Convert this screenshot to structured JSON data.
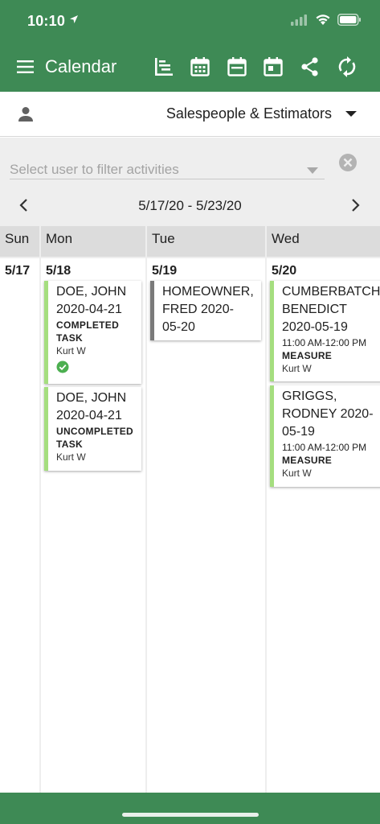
{
  "status": {
    "time": "10:10"
  },
  "toolbar": {
    "title": "Calendar",
    "icons": [
      "menu-icon",
      "gantt-view-icon",
      "month-view-icon",
      "week-view-icon",
      "day-view-icon",
      "share-icon",
      "sync-icon"
    ]
  },
  "filters": {
    "group_label": "Salespeople & Estimators",
    "user_placeholder": "Select user to filter activities"
  },
  "week": {
    "range": "5/17/20 - 5/23/20"
  },
  "days": [
    {
      "name": "Sun",
      "date": "5/17"
    },
    {
      "name": "Mon",
      "date": "5/18"
    },
    {
      "name": "Tue",
      "date": "5/19"
    },
    {
      "name": "Wed",
      "date": "5/20"
    }
  ],
  "events": {
    "mon": [
      {
        "title": "DOE, JOHN\n2020-04-21",
        "type": "COMPLETED\nTASK",
        "user": "Kurt W",
        "completed": true
      },
      {
        "title": "DOE, JOHN\n2020-04-21",
        "type": "UNCOMPLETED\nTASK",
        "user": "Kurt W"
      }
    ],
    "tue": [
      {
        "title": "HOMEOWNER,\nFRED 2020-\n05-20"
      }
    ],
    "wed": [
      {
        "title": "CUMBERBATCH\nBENEDICT\n2020-05-19",
        "time": "11:00 AM-12:00 PM",
        "type": "MEASURE",
        "user": "Kurt W"
      },
      {
        "title": "GRIGGS,\nRODNEY 2020-\n05-19",
        "time": "11:00 AM-12:00 PM",
        "type": "MEASURE",
        "user": "Kurt W"
      }
    ]
  },
  "colors": {
    "brand_green": "#3e8a55",
    "event_green": "#a5de7f",
    "event_gray": "#7a7a7a",
    "check_green": "#4caf50"
  }
}
